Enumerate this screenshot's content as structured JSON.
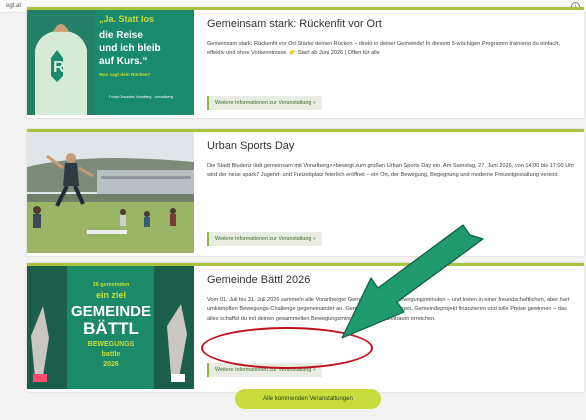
{
  "browser": {
    "url": "egt.at"
  },
  "events": [
    {
      "title": "Gemeinsam stark: Rückenfit vor Ort",
      "description": "Gemeinsam stark: Rückenfit vor Ort Stärke deinen Rücken – direkt in deiner Gemeinde! In diesem 5-wöchigen Programm trainierst du einfach, effektiv und ohne Vorkenntnisse. 👉 Start ab Juni 2026 | Offen für alle",
      "more_label": "Weitere Informationen zur Veranstaltung »",
      "image": {
        "line1": "die Reise",
        "line2": "und ich bleib",
        "line3": "auf Kurs.“",
        "top_text": "„Ja. Statt los",
        "question": "Was sagt dein Rücken?",
        "logo_text": "Fonds Gesundes Vorarlberg",
        "logo2": "vorarlberg"
      }
    },
    {
      "title": "Urban Sports Day",
      "description": "Die Stadt Bludenz lädt gemeinsam mit Vorarlberg>>bewegt zum großen Urban Sports Day ein. Am Samstag, 27. Juni 2026, von 14:00 bis 17:00 Uhr wird der neue spark7 Jugend- und Freizeitplatz feierlich eröffnet – ein Ort, der Bewegung, Begegnung und moderne Freizeitgestaltung vereint.",
      "more_label": "Weitere Informationen zur Veranstaltung »"
    },
    {
      "title": "Gemeinde Bättl 2026",
      "description": "Vom 01. Juli bis 31. Juli 2026 sammeln alle Vorarlberger Gemeinden wieder Bewegungsminuten – und treten in einer freundschaftlichen, aber hart umkämpften Bewegungs-Challenge gegeneinander an. Gemeindeehre verteidigen, Gemeindeprojekt finanzieren und tolle Preise gewinnen – das alles schaffst du mit deinen gesammelten Bewegungsminuten in diesem Zeitraum erreichen.",
      "more_label": "Weitere Informationen zur Veranstaltung »",
      "image": {
        "small": "36 gemeinden",
        "mid": "ein ziel",
        "big1": "GEMEINDE",
        "big2": "BÄTTL",
        "sub": "BEWEGUNGS",
        "sub2": "battle",
        "sub3": "2026"
      }
    }
  ],
  "all_events_label": "Alle kommenden Veranstaltungen",
  "colors": {
    "accent_lime": "#c8dd3c",
    "card_border": "#a9c33c",
    "annotation_arrow": "#1f9a6e",
    "annotation_circle": "#c0121e"
  }
}
